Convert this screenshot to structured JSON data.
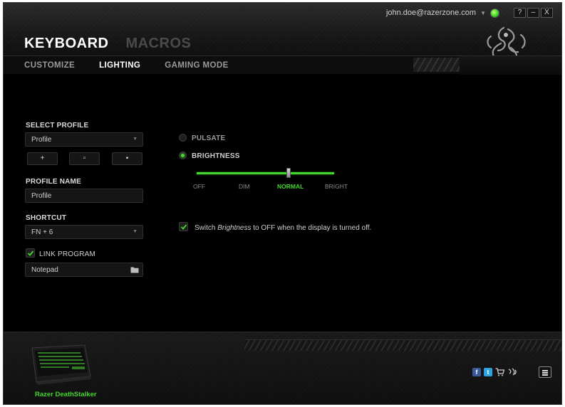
{
  "user": {
    "email": "john.doe@razerzone.com"
  },
  "window_controls": {
    "help": "?",
    "minimize": "–",
    "close": "X"
  },
  "header": {
    "title_active": "KEYBOARD",
    "title_inactive": "MACROS",
    "tabs": [
      {
        "label": "CUSTOMIZE",
        "active": false
      },
      {
        "label": "LIGHTING",
        "active": true
      },
      {
        "label": "GAMING MODE",
        "active": false
      }
    ]
  },
  "left_panel": {
    "select_profile_label": "SELECT PROFILE",
    "profile_select_value": "Profile",
    "profile_buttons": {
      "add": "+",
      "copy": "▫",
      "delete": "▪"
    },
    "profile_name_label": "PROFILE NAME",
    "profile_name_value": "Profile",
    "shortcut_label": "SHORTCUT",
    "shortcut_value": "FN + 6",
    "link_program_label": "LINK PROGRAM",
    "link_program_checked": true,
    "linked_program_value": "Notepad"
  },
  "lighting": {
    "pulsate_label": "PULSATE",
    "pulsate_selected": false,
    "brightness_label": "BRIGHTNESS",
    "brightness_selected": true,
    "brightness_levels": [
      "OFF",
      "DIM",
      "NORMAL",
      "BRIGHT"
    ],
    "brightness_current": "NORMAL",
    "note_prefix": "Switch ",
    "note_italic": "Brightness",
    "note_suffix": " to OFF when the display is turned off.",
    "note_checked": true
  },
  "footer": {
    "device_name": "Razer DeathStalker",
    "social_icons": [
      "facebook-icon",
      "twitter-icon",
      "cart-icon",
      "razer-icon"
    ]
  },
  "colors": {
    "accent": "#44d62c",
    "background": "#000000"
  }
}
